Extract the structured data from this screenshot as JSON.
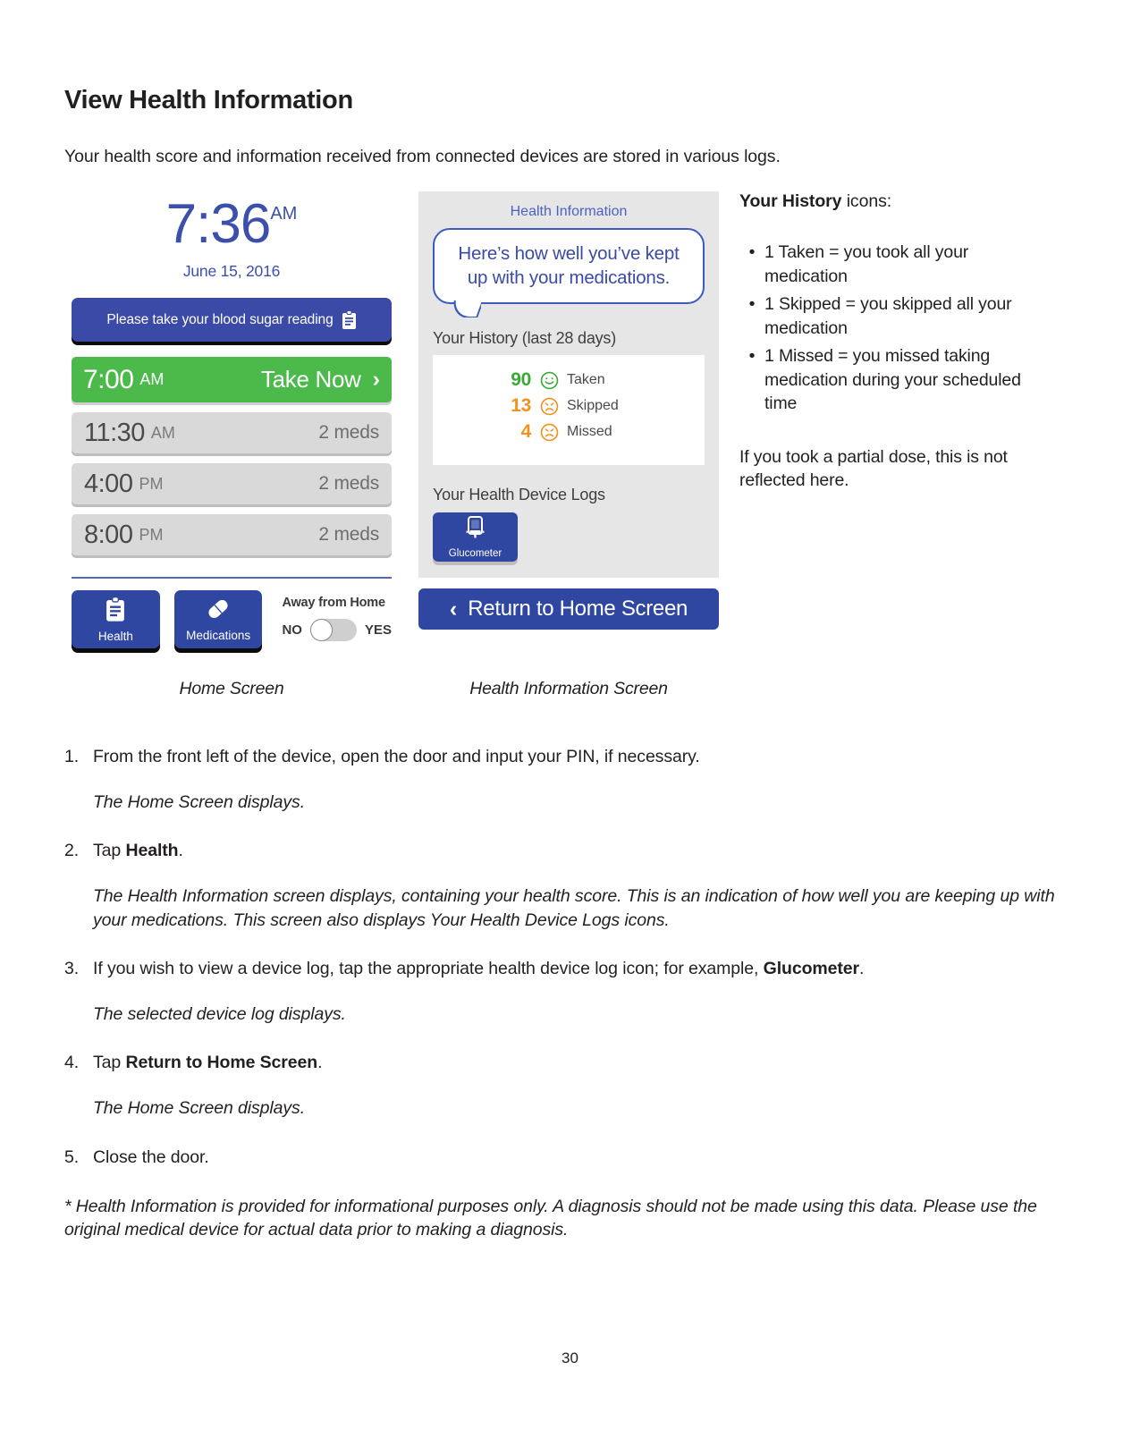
{
  "document": {
    "title": "View Health Information",
    "intro": "Your health score and information received from connected devices are stored in various logs.",
    "page_number": "30"
  },
  "home_screen": {
    "caption": "Home Screen",
    "clock": {
      "time": "7:36",
      "meridiem": "AM",
      "date": "June 15, 2016"
    },
    "banner": {
      "label": "Please take your blood sugar reading",
      "icon": "clipboard-icon"
    },
    "schedule": [
      {
        "time": "7:00",
        "meridiem": "AM",
        "detail": "Take Now",
        "state": "active",
        "chevron": "›"
      },
      {
        "time": "11:30",
        "meridiem": "AM",
        "detail": "2 meds",
        "state": "pending"
      },
      {
        "time": "4:00",
        "meridiem": "PM",
        "detail": "2 meds",
        "state": "pending"
      },
      {
        "time": "8:00",
        "meridiem": "PM",
        "detail": "2 meds",
        "state": "pending"
      }
    ],
    "nav": [
      {
        "label": "Health",
        "icon": "clipboard-icon"
      },
      {
        "label": "Medications",
        "icon": "pill-icon"
      }
    ],
    "away_from_home": {
      "title": "Away from Home",
      "off_label": "NO",
      "on_label": "YES",
      "value": "NO"
    }
  },
  "health_screen": {
    "caption": "Health Information Screen",
    "title": "Health Information",
    "bubble_text": "Here’s how well you’ve kept up with your medications.",
    "history_label": "Your History (last 28 days)",
    "history": [
      {
        "count": "90",
        "face": "smiley-face-icon",
        "label": "Taken",
        "color": "#3aaa35"
      },
      {
        "count": "13",
        "face": "frowny-face-icon",
        "label": "Skipped",
        "color": "#f0921e"
      },
      {
        "count": "4",
        "face": "frowny-face-icon",
        "label": "Missed",
        "color": "#f0921e"
      }
    ],
    "device_logs_label": "Your Health Device Logs",
    "devices": [
      {
        "label": "Glucometer",
        "icon": "glucometer-icon"
      }
    ],
    "return_button": {
      "label": "Return to Home Screen",
      "chevron": "‹"
    }
  },
  "notes": {
    "heading_bold": "Your History",
    "heading_rest": " icons:",
    "bullets": [
      "1 Taken = you took all your medication",
      "1 Skipped = you skipped all your medication",
      "1 Missed = you missed taking medication during your scheduled time"
    ],
    "tail": "If you took a partial dose, this is not reflected here."
  },
  "steps": [
    {
      "num": "1.",
      "text": "From the front left of the device, open the door and input your PIN, if necessary.",
      "result": "The Home Screen displays."
    },
    {
      "num": "2.",
      "pre": "Tap ",
      "bold": "Health",
      "post": ".",
      "result": "The Health Information screen displays, containing your health score.  This is an indication of how well you are keeping up with your medications.  This screen also displays Your Health Device Logs icons."
    },
    {
      "num": "3.",
      "pre": "If you wish to view a device log, tap the appropriate health device log icon; for example, ",
      "bold": "Glucometer",
      "post": ".",
      "result": "The selected device log displays."
    },
    {
      "num": "4.",
      "pre": "Tap ",
      "bold": "Return to Home Screen",
      "post": ".",
      "result": "The Home Screen displays."
    },
    {
      "num": "5.",
      "text": "Close the door."
    }
  ],
  "footnote": "* Health Information is provided for informational purposes only.  A diagnosis should not be made using this data.  Please use the original medical device for actual data prior to making a diagnosis.",
  "colors": {
    "blue": "#3b4aa6",
    "nav_blue": "#2f47a0",
    "green": "#4cb94b",
    "orange": "#f0921e",
    "stat_green": "#3aaa35",
    "grey_row": "#d9d9d9",
    "screen_bg": "#e6e6e6"
  }
}
